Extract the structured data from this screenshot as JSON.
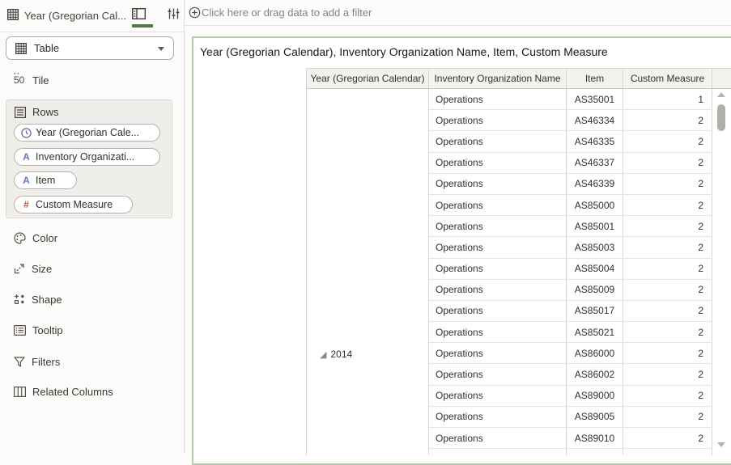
{
  "tab": {
    "title": "Year (Gregorian Cal..."
  },
  "filter_bar": {
    "text": "Click here or drag data to add a filter"
  },
  "sidebar": {
    "viz_type_label": "Table",
    "tile_label": "Tile",
    "tile_icon_text": "50",
    "rows_section": {
      "label": "Rows",
      "pills": [
        {
          "label": "Year (Gregorian Cale...",
          "type": "time"
        },
        {
          "label": "Inventory Organizati...",
          "type": "text"
        },
        {
          "label": "Item",
          "type": "text"
        },
        {
          "label": "Custom Measure",
          "type": "number"
        }
      ]
    },
    "items": [
      {
        "label": "Color"
      },
      {
        "label": "Size"
      },
      {
        "label": "Shape"
      },
      {
        "label": "Tooltip"
      },
      {
        "label": "Filters"
      },
      {
        "label": "Related Columns"
      }
    ]
  },
  "canvas": {
    "title": "Year (Gregorian Calendar), Inventory Organization Name, Item, Custom Measure",
    "table": {
      "columns": [
        "Year (Gregorian Calendar)",
        "Inventory Organization Name",
        "Item",
        "Custom Measure"
      ],
      "year_group": "2014",
      "rows": [
        {
          "org": "Operations",
          "item": "AS35001",
          "measure": "1"
        },
        {
          "org": "Operations",
          "item": "AS46334",
          "measure": "2"
        },
        {
          "org": "Operations",
          "item": "AS46335",
          "measure": "2"
        },
        {
          "org": "Operations",
          "item": "AS46337",
          "measure": "2"
        },
        {
          "org": "Operations",
          "item": "AS46339",
          "measure": "2"
        },
        {
          "org": "Operations",
          "item": "AS85000",
          "measure": "2"
        },
        {
          "org": "Operations",
          "item": "AS85001",
          "measure": "2"
        },
        {
          "org": "Operations",
          "item": "AS85003",
          "measure": "2"
        },
        {
          "org": "Operations",
          "item": "AS85004",
          "measure": "2"
        },
        {
          "org": "Operations",
          "item": "AS85009",
          "measure": "2"
        },
        {
          "org": "Operations",
          "item": "AS85017",
          "measure": "2"
        },
        {
          "org": "Operations",
          "item": "AS85021",
          "measure": "2"
        },
        {
          "org": "Operations",
          "item": "AS86000",
          "measure": "2"
        },
        {
          "org": "Operations",
          "item": "AS86002",
          "measure": "2"
        },
        {
          "org": "Operations",
          "item": "AS89000",
          "measure": "2"
        },
        {
          "org": "Operations",
          "item": "AS89005",
          "measure": "2"
        },
        {
          "org": "Operations",
          "item": "AS89010",
          "measure": "2"
        }
      ]
    }
  },
  "colors": {
    "accent_green": "#4e7a46",
    "selection_border": "#b3c9ac",
    "time_icon": "#7a5ca6",
    "text_icon": "#5b7cc6",
    "number_icon": "#c2543e"
  }
}
